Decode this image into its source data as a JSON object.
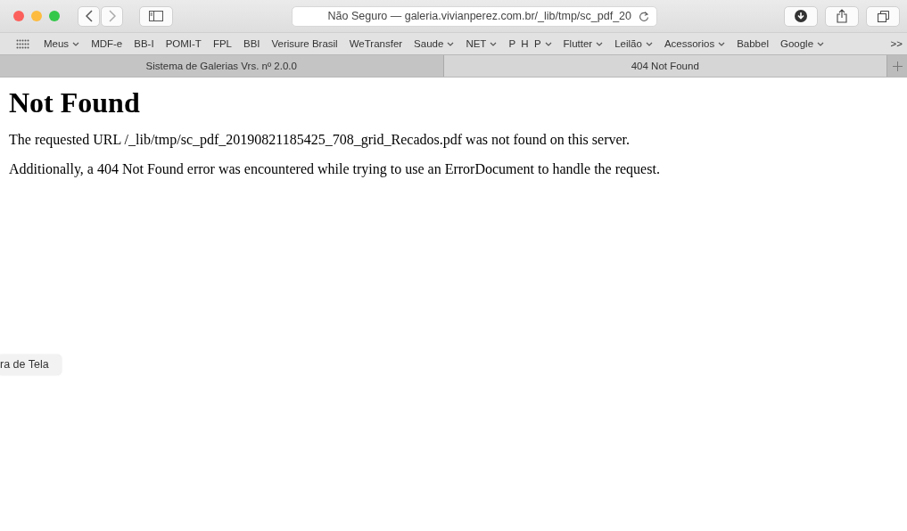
{
  "toolbar": {
    "address": "Não Seguro — galeria.vivianperez.com.br/_lib/tmp/sc_pdf_20"
  },
  "bookmarks": [
    {
      "label": "Meus",
      "dropdown": true
    },
    {
      "label": "MDF-e",
      "dropdown": false
    },
    {
      "label": "BB-I",
      "dropdown": false
    },
    {
      "label": "POMI-T",
      "dropdown": false
    },
    {
      "label": "FPL",
      "dropdown": false
    },
    {
      "label": "BBI",
      "dropdown": false
    },
    {
      "label": "Verisure Brasil",
      "dropdown": false
    },
    {
      "label": "WeTransfer",
      "dropdown": false
    },
    {
      "label": "Saude",
      "dropdown": true
    },
    {
      "label": "NET",
      "dropdown": true
    },
    {
      "label": "P  H  P",
      "dropdown": true
    },
    {
      "label": "Flutter",
      "dropdown": true
    },
    {
      "label": "Leilão",
      "dropdown": true
    },
    {
      "label": "Acessorios",
      "dropdown": true
    },
    {
      "label": "Babbel",
      "dropdown": false
    },
    {
      "label": "Google",
      "dropdown": true
    }
  ],
  "bookmarks_more": ">>",
  "tabs": [
    {
      "label": "Sistema de Galerias Vrs. nº 2.0.0",
      "selected": false
    },
    {
      "label": "404 Not Found",
      "selected": true
    }
  ],
  "page": {
    "heading": "Not Found",
    "paragraphs": [
      "The requested URL /_lib/tmp/sc_pdf_20190821185425_708_grid_Recados.pdf was not found on this server.",
      "Additionally, a 404 Not Found error was encountered while trying to use an ErrorDocument to handle the request."
    ]
  },
  "tooltip": "ra de Tela"
}
